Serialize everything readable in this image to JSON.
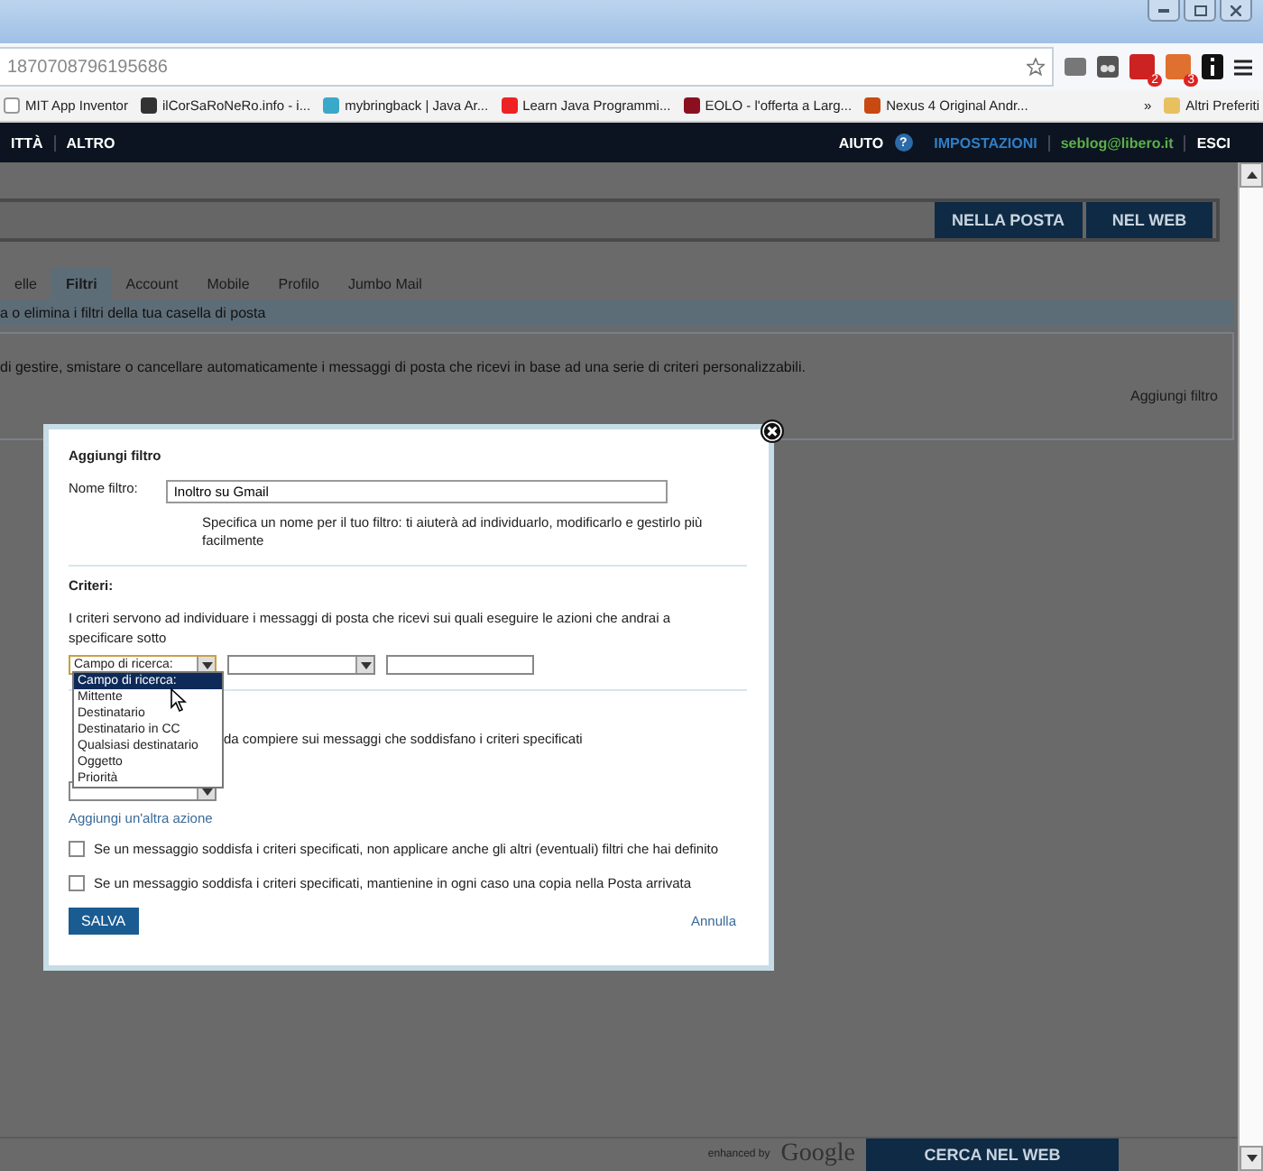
{
  "browser": {
    "url": "1870708796195686",
    "bookmarks": [
      {
        "label": "MIT App Inventor",
        "kind": "page"
      },
      {
        "label": "ilCorSaRoNeRo.info - i...",
        "kind": "skull"
      },
      {
        "label": "mybringback | Java Ar...",
        "kind": "star"
      },
      {
        "label": "Learn Java Programmi...",
        "kind": "video"
      },
      {
        "label": "EOLO - l'offerta a Larg...",
        "kind": "red"
      },
      {
        "label": "Nexus 4 Original Andr...",
        "kind": "orange"
      }
    ],
    "more": "»",
    "other_bookmarks": "Altri Preferiti",
    "badges": [
      "2",
      "3"
    ]
  },
  "nav": {
    "items": [
      "ITTÀ",
      "ALTRO"
    ],
    "help": "AIUTO",
    "help_icon": "?",
    "settings": "IMPOSTAZIONI",
    "user": "seblog@libero.it",
    "logout": "ESCI"
  },
  "search": {
    "buttons": [
      "NELLA POSTA",
      "NEL WEB"
    ]
  },
  "tabs": [
    {
      "label": "elle",
      "selected": false
    },
    {
      "label": "Filtri",
      "selected": true
    },
    {
      "label": "Account",
      "selected": false
    },
    {
      "label": "Mobile",
      "selected": false
    },
    {
      "label": "Profilo",
      "selected": false
    },
    {
      "label": "Jumbo Mail",
      "selected": false
    }
  ],
  "band": "a o elimina i filtri della tua casella di posta",
  "intro": "di gestire, smistare o cancellare automaticamente i messaggi di posta che ricevi in base ad una serie di criteri personalizzabili.",
  "add_filter": "Aggiungi filtro",
  "footer": {
    "enhanced": "enhanced by",
    "google": "Google",
    "button": "CERCA NEL WEB"
  },
  "modal": {
    "title": "Aggiungi filtro",
    "name_label": "Nome filtro:",
    "name_value": "Inoltro su Gmail",
    "name_hint": "Specifica un nome per il tuo filtro: ti aiuterà ad individuarlo, modificarlo e gestirlo più facilmente",
    "criteria_heading": "Criteri:",
    "criteria_text": "I criteri servono ad individuare i messaggi di posta che ricevi sui quali eseguire le azioni che andrai a specificare sotto",
    "field_select": "Campo di ricerca:",
    "options": [
      {
        "label": "Campo di ricerca:",
        "selected": true
      },
      {
        "label": "Mittente",
        "selected": false
      },
      {
        "label": "Destinatario",
        "selected": false
      },
      {
        "label": "Destinatario in CC",
        "selected": false
      },
      {
        "label": "Qualsiasi destinatario",
        "selected": false
      },
      {
        "label": "Oggetto",
        "selected": false
      },
      {
        "label": "Priorità",
        "selected": false
      }
    ],
    "actions_text": "da compiere sui messaggi che soddisfano i criteri specificati",
    "add_action": "Aggiungi un'altra azione",
    "checks": [
      {
        "label": "Se un messaggio soddisfa i criteri specificati, non applicare anche gli altri (eventuali) filtri che hai definito",
        "checked": false
      },
      {
        "label": "Se un messaggio soddisfa i criteri specificati, mantienine in ogni caso una copia nella Posta arrivata",
        "checked": false
      }
    ],
    "save": "SALVA",
    "cancel": "Annulla"
  }
}
